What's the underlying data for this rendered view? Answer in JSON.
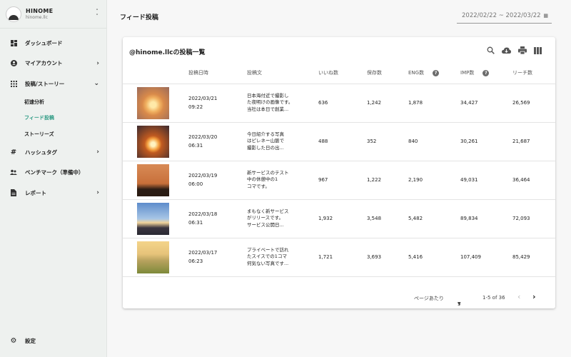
{
  "brand": {
    "name": "HINOME",
    "sub": "hinome.llc"
  },
  "sidebar": {
    "items": [
      {
        "label": "ダッシュボード",
        "icon": "dashboard-icon"
      },
      {
        "label": "マイアカウント",
        "icon": "account-icon"
      },
      {
        "label": "投稿/ストーリー",
        "icon": "grid-icon"
      },
      {
        "label": "ハッシュタグ",
        "icon": "hashtag-icon"
      },
      {
        "label": "ベンチマーク（準備中）",
        "icon": "group-icon"
      },
      {
        "label": "レポート",
        "icon": "report-icon"
      }
    ],
    "subitems": [
      {
        "label": "初速分析"
      },
      {
        "label": "フィード投稿",
        "active": true
      },
      {
        "label": "ストーリーズ"
      }
    ],
    "settings": "設定"
  },
  "header": {
    "title": "フィード投稿",
    "date_range": "2022/02/22 ~ 2022/03/22"
  },
  "card": {
    "title": "@hinome.llcの投稿一覧",
    "tools": [
      "search-icon",
      "download-icon",
      "print-icon",
      "columns-icon"
    ]
  },
  "table": {
    "headers": [
      "投稿日時",
      "投稿文",
      "いいね数",
      "保存数",
      "ENG数",
      "IMP数",
      "リーチ数"
    ],
    "rows": [
      {
        "date": "2022/03/21",
        "time": "09:22",
        "text1": "日本海付近で撮影し",
        "text2": "た夜明けの画像です。",
        "text3": "当社は本日で創業...",
        "likes": "636",
        "saves": "1,242",
        "eng": "1,878",
        "imp": "34,427",
        "reach": "26,569"
      },
      {
        "date": "2022/03/20",
        "time": "06:31",
        "text1": "今日紹介する写真",
        "text2": "はピレネー山脈で",
        "text3": "撮影した日の出...",
        "likes": "488",
        "saves": "352",
        "eng": "840",
        "imp": "30,261",
        "reach": "21,687"
      },
      {
        "date": "2022/03/19",
        "time": "06:00",
        "text1": "新サービスのテスト",
        "text2": "中の休憩中の1",
        "text3": "コマです。",
        "likes": "967",
        "saves": "1,222",
        "eng": "2,190",
        "imp": "49,031",
        "reach": "36,464"
      },
      {
        "date": "2022/03/18",
        "time": "06:31",
        "text1": "まもなく新サービス",
        "text2": "がリリースです。",
        "text3": "サービス公開日...",
        "likes": "1,932",
        "saves": "3,548",
        "eng": "5,482",
        "imp": "89,834",
        "reach": "72,093"
      },
      {
        "date": "2022/03/17",
        "time": "06:23",
        "text1": "プライベートで訪れ",
        "text2": "たスイスでの1コマ",
        "text3": "何気ない写真です...",
        "likes": "1,721",
        "saves": "3,693",
        "eng": "5,416",
        "imp": "107,409",
        "reach": "85,429"
      }
    ]
  },
  "footer": {
    "per_page_label": "ページあたり",
    "per_page_value": "5",
    "range": "1-5 of 36"
  },
  "colors": {
    "accent": "#2e9b84",
    "sidebar_bg": "#eef1ef"
  }
}
